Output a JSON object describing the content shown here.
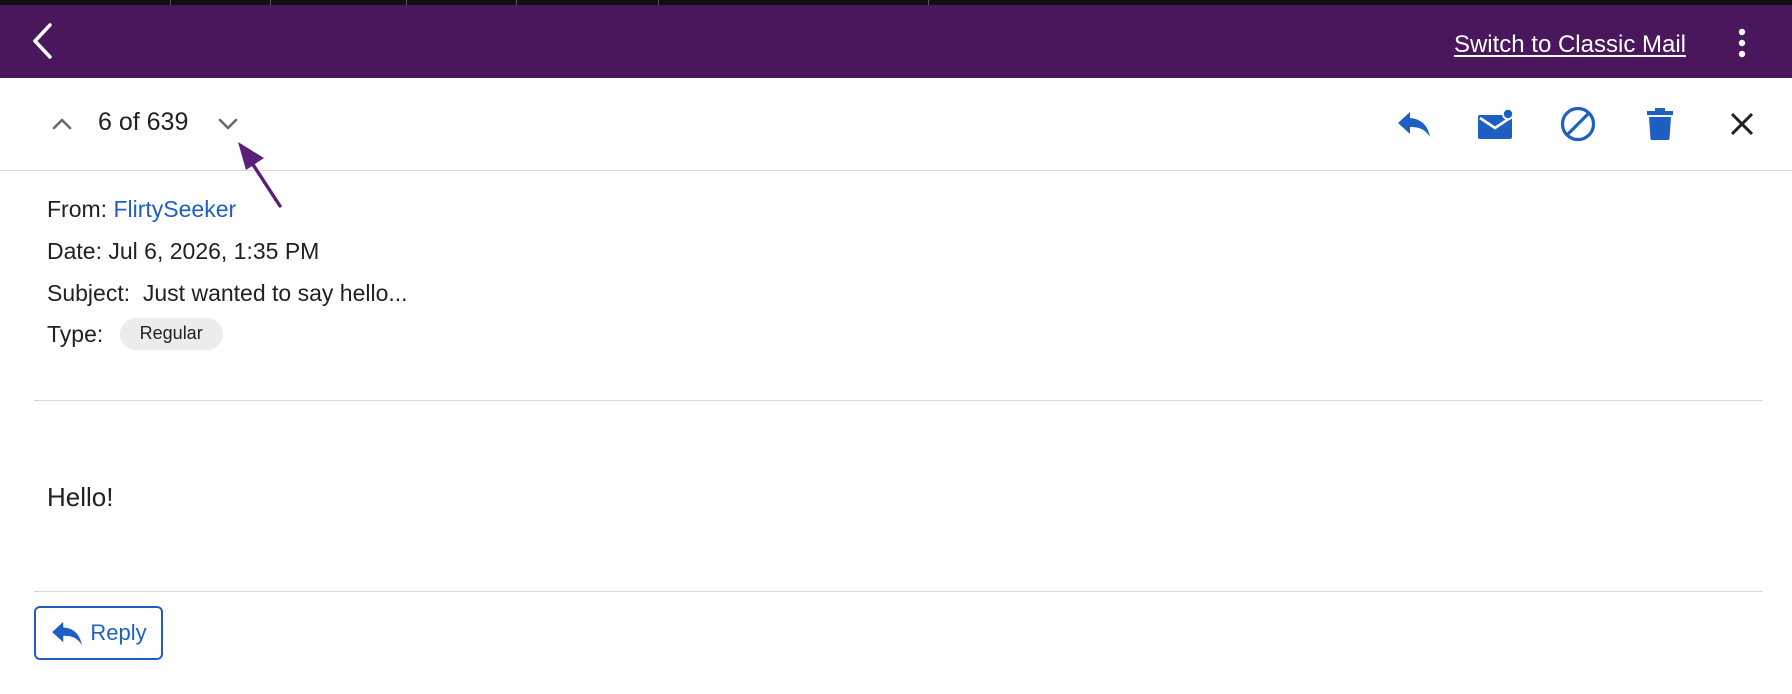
{
  "header": {
    "switch_label": "Switch to Classic Mail",
    "background": "#4a175d",
    "icons": {
      "back": "chevron-left-icon",
      "more": "more-vertical-icon"
    }
  },
  "toolbar": {
    "counter": "6 of 639",
    "icons": {
      "prev": "chevron-up-icon",
      "next": "chevron-down-icon",
      "reply": "reply-icon",
      "mark_unread": "mark-unread-icon",
      "block": "block-icon",
      "delete": "trash-icon",
      "close": "close-icon"
    },
    "accent": "#1f5fc4"
  },
  "message": {
    "from_label": "From:",
    "from_name": "FlirtySeeker",
    "date_label": "Date:",
    "date_value": "Jul 6, 2026, 1:35 PM",
    "subject_label": "Subject:",
    "subject_value": "Just wanted to say hello...",
    "type_label": "Type:",
    "type_value": "Regular",
    "body": "Hello!"
  },
  "reply_button": {
    "label": "Reply",
    "icon": "reply-icon"
  }
}
